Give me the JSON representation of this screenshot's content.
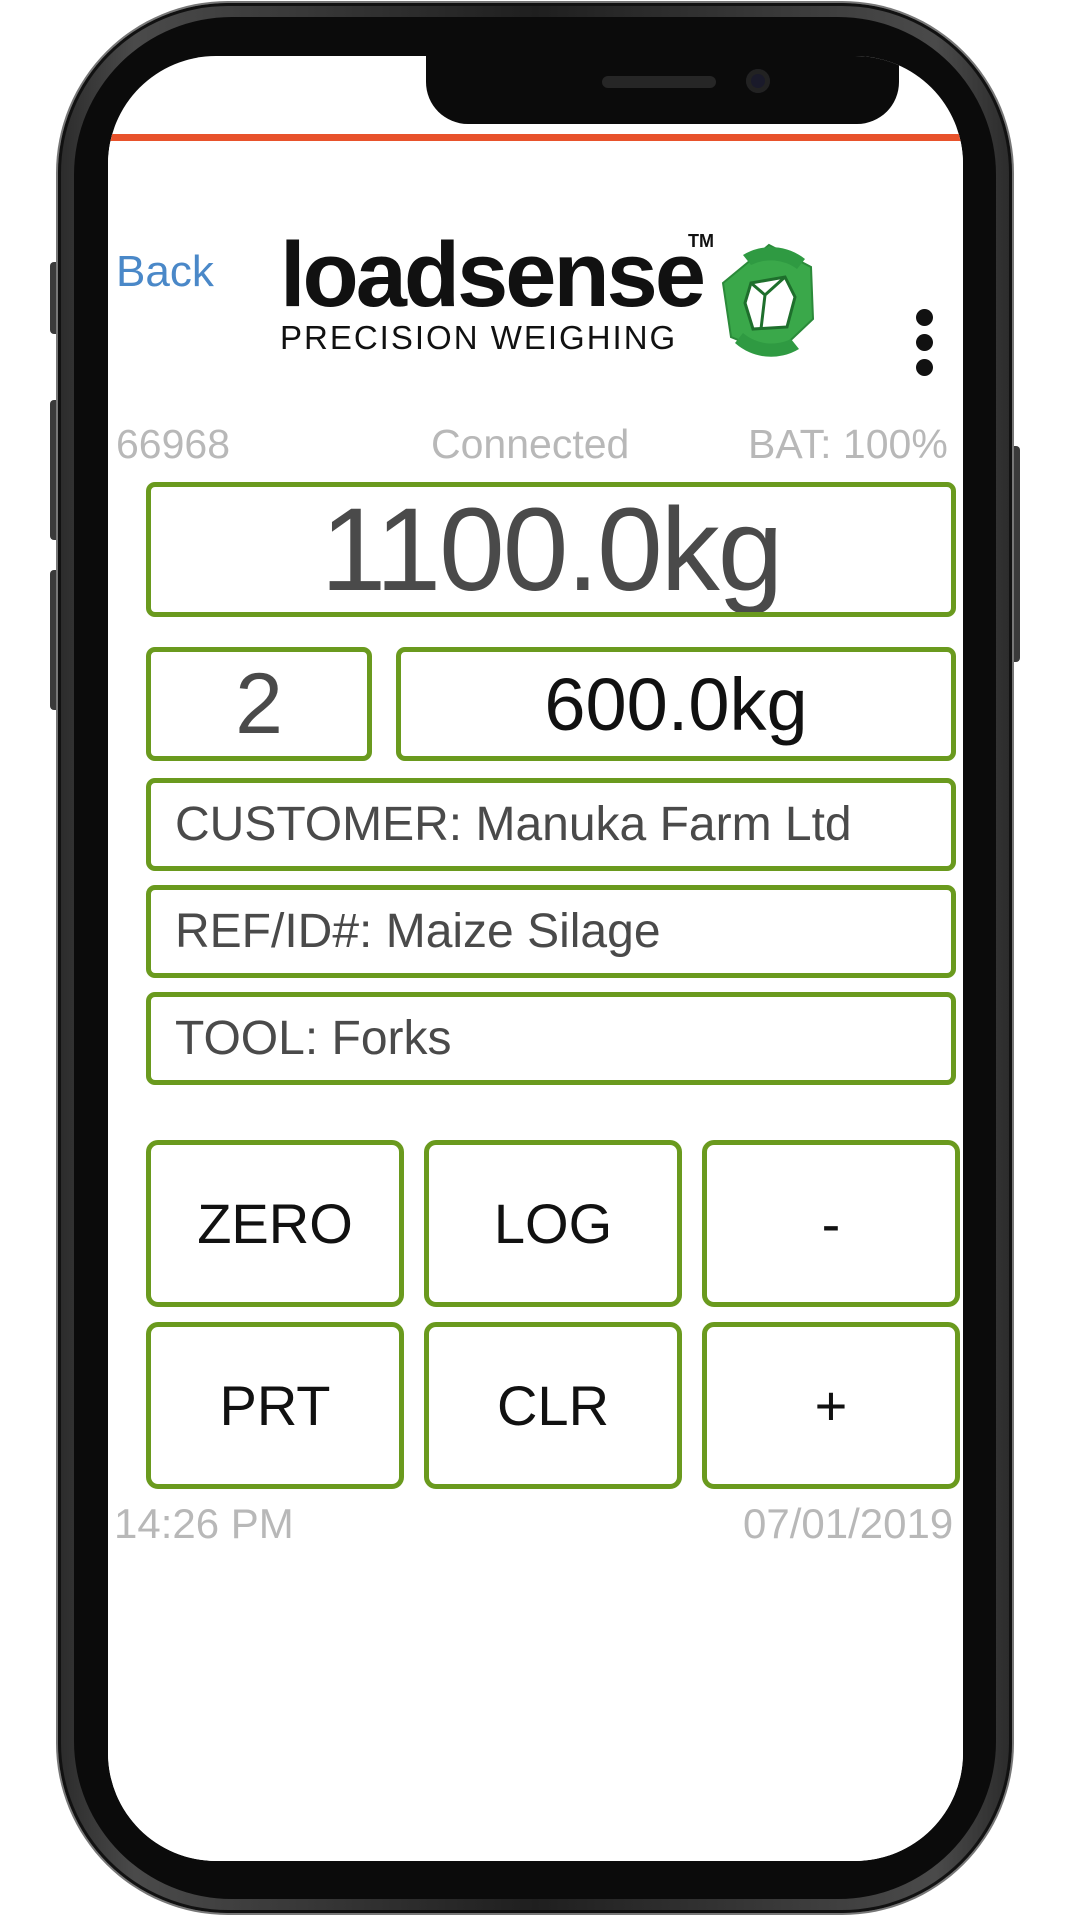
{
  "header": {
    "back_label": "Back",
    "logo_word": "loadsense",
    "logo_tm": "TM",
    "logo_tagline": "PRECISION WEIGHING"
  },
  "status": {
    "device_id": "66968",
    "connection": "Connected",
    "battery": "BAT: 100%"
  },
  "weights": {
    "total": "1100.0kg",
    "load_count": "2",
    "last_load": "600.0kg"
  },
  "info": {
    "customer": "CUSTOMER: Manuka Farm Ltd",
    "reference": "REF/ID#: Maize Silage",
    "tool": "TOOL: Forks"
  },
  "keypad": {
    "zero": "ZERO",
    "log": "LOG",
    "minus": "-",
    "print": "PRT",
    "clear": "CLR",
    "plus": "+"
  },
  "footer": {
    "time": "14:26 PM",
    "date": "07/01/2019"
  },
  "colors": {
    "accent_bar": "#e8522b",
    "box_border": "#6a9a1e",
    "link": "#4a88c8",
    "logo_green": "#3aa84a",
    "muted_text": "#b8b8b8"
  },
  "icons": {
    "menu": "more-vertical-icon",
    "logo": "loadsense-logo-icon"
  }
}
